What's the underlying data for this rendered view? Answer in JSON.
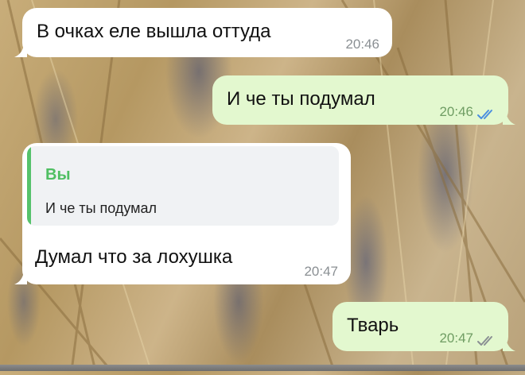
{
  "messages": [
    {
      "direction": "incoming",
      "text": "В очках еле вышла оттуда",
      "time": "20:46"
    },
    {
      "direction": "outgoing",
      "text": "И че ты подумал",
      "time": "20:46",
      "status": "read"
    },
    {
      "direction": "incoming",
      "reply": {
        "author": "Вы",
        "text": "И че ты подумал"
      },
      "text": "Думал что за лохушка",
      "time": "20:47"
    },
    {
      "direction": "outgoing",
      "text": "Тварь",
      "time": "20:47",
      "status": "delivered"
    }
  ],
  "colors": {
    "incoming_bubble": "#ffffff",
    "outgoing_bubble": "#e3f8cf",
    "reply_accent": "#4fbf62",
    "read_check": "#4b8fe0"
  }
}
